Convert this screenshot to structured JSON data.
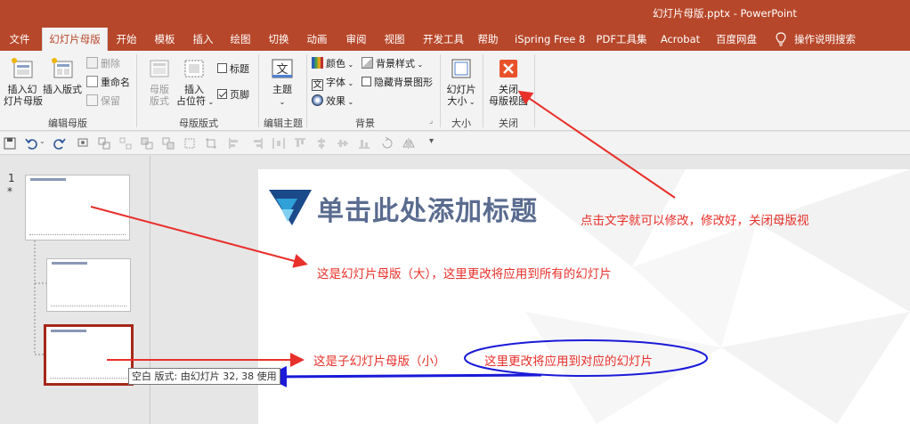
{
  "window": {
    "title": "幻灯片母版.pptx  -  PowerPoint"
  },
  "tabs": [
    {
      "label": "文件"
    },
    {
      "label": "幻灯片母版"
    },
    {
      "label": "开始"
    },
    {
      "label": "模板"
    },
    {
      "label": "插入"
    },
    {
      "label": "绘图"
    },
    {
      "label": "切换"
    },
    {
      "label": "动画"
    },
    {
      "label": "审阅"
    },
    {
      "label": "视图"
    },
    {
      "label": "开发工具"
    },
    {
      "label": "帮助"
    },
    {
      "label": "iSpring Free 8"
    },
    {
      "label": "PDF工具集"
    },
    {
      "label": "Acrobat"
    },
    {
      "label": "百度网盘"
    }
  ],
  "tell_me": "操作说明搜索",
  "ribbon": {
    "edit_master": {
      "label": "编辑母版",
      "insert_slide_master_l1": "插入幻",
      "insert_slide_master_l2": "灯片母版",
      "insert_layout": "插入版式",
      "delete": "删除",
      "rename": "重命名",
      "preserve": "保留"
    },
    "master_layout": {
      "label": "母版版式",
      "master_layout_l1": "母版",
      "master_layout_l2": "版式",
      "insert_placeholder_l1": "插入",
      "insert_placeholder_l2": "占位符",
      "title_check": "标题",
      "footer_check": "页脚"
    },
    "edit_theme": {
      "label": "编辑主题",
      "themes": "主题"
    },
    "background": {
      "label": "背景",
      "colors": "颜色",
      "fonts": "字体",
      "effects": "效果",
      "bg_styles": "背景样式",
      "hide_bg": "隐藏背景图形"
    },
    "size": {
      "label": "大小",
      "slide_size_l1": "幻灯片",
      "slide_size_l2": "大小"
    },
    "close": {
      "label": "关闭",
      "close_l1": "关闭",
      "close_l2": "母版视图"
    }
  },
  "thumbnails": {
    "slide_number": "1",
    "star": "*"
  },
  "tooltip": "空白 版式: 由幻灯片 32, 38 使用",
  "slide": {
    "title": "单击此处添加标题"
  },
  "annotations": {
    "close_note": "点击文字就可以修改，修改好，关闭母版视",
    "master_note": "这是幻灯片母版（大），这里更改将应用到所有的幻灯片",
    "child_note": "这是子幻灯片母版（小）",
    "child_note2": "这里更改将应用到对应的幻灯片"
  },
  "colors": {
    "accent": "#b7472a",
    "annotation_red": "#e8302a",
    "annotation_blue": "#1a1ad8",
    "title_text": "#5a6c8f",
    "selected_thumb": "#a5281a"
  }
}
